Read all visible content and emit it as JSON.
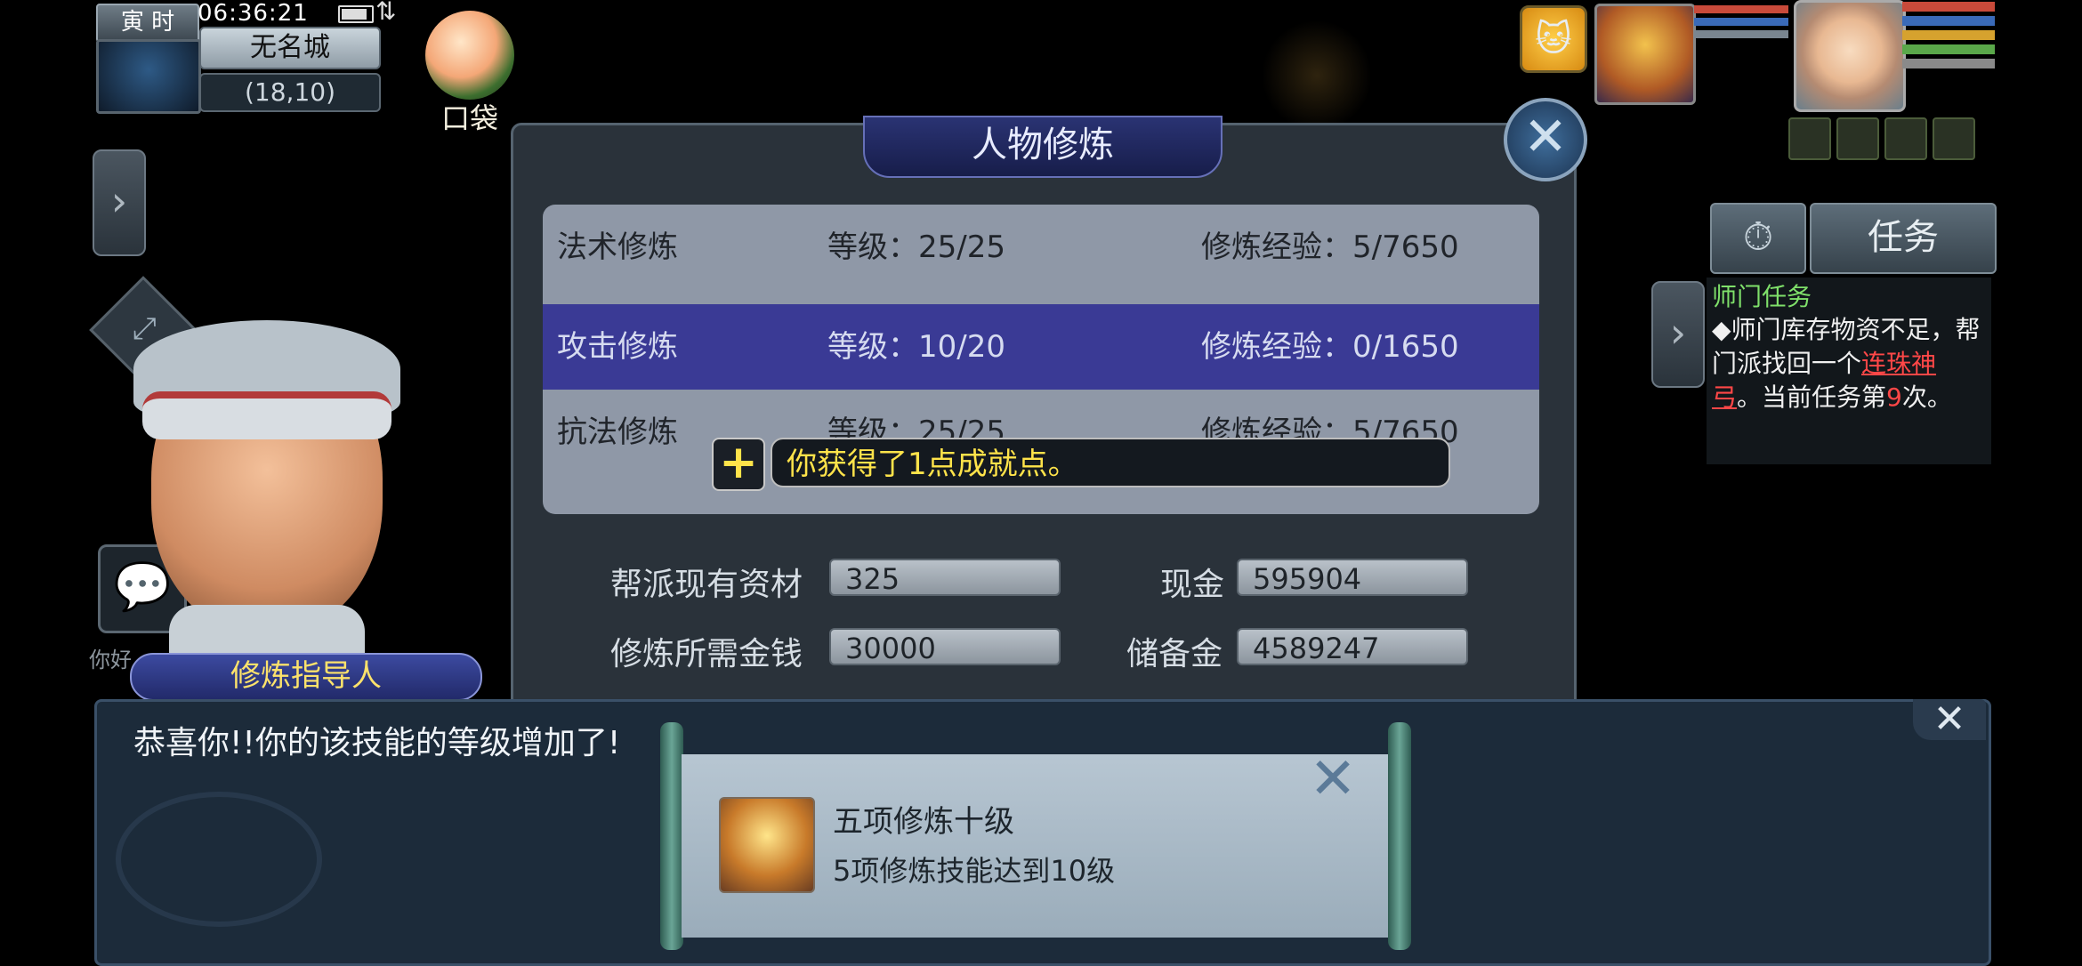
{
  "hud": {
    "time_tag": "寅 时",
    "clock": "06:36:21",
    "city": "无名城",
    "coords": "(18,10)",
    "bag_label": "口袋",
    "chat_hint": "你好"
  },
  "npc": {
    "name": "修炼指导人"
  },
  "panel": {
    "title": "人物修炼",
    "close": "✕",
    "rows": [
      {
        "name": "法术修炼",
        "level": "等级：25/25",
        "exp": "修炼经验：5/7650"
      },
      {
        "name": "攻击修炼",
        "level": "等级：10/20",
        "exp": "修炼经验：0/1650"
      },
      {
        "name": "抗法修炼",
        "level": "等级：25/25",
        "exp": "修炼经验：5/7650"
      }
    ],
    "toast": "你获得了1点成就点。",
    "fields": {
      "guild_label": "帮派现有资材",
      "guild_value": "325",
      "cash_label": "现金",
      "cash_value": "595904",
      "cost_label": "修炼所需金钱",
      "cost_value": "30000",
      "reserve_label": "储备金",
      "reserve_value": "4589247"
    }
  },
  "task": {
    "btn_label": "任务",
    "title": "师门任务",
    "text_a": "◆师门库存物资不足，帮门派找回一个",
    "item": "连珠神弓",
    "text_b": "。当前任务第",
    "count": "9",
    "text_c": "次。"
  },
  "dialog": {
    "text": "恭喜你!!你的该技能的等级增加了!",
    "close": "✕",
    "achievement_title": "五项修炼十级",
    "achievement_desc": "5项修炼技能达到10级"
  },
  "colors": {
    "accent_yellow": "#ffe34a",
    "task_green": "#7fe06a",
    "link_red": "#ff4747",
    "selected_row": "#3a3a95"
  }
}
